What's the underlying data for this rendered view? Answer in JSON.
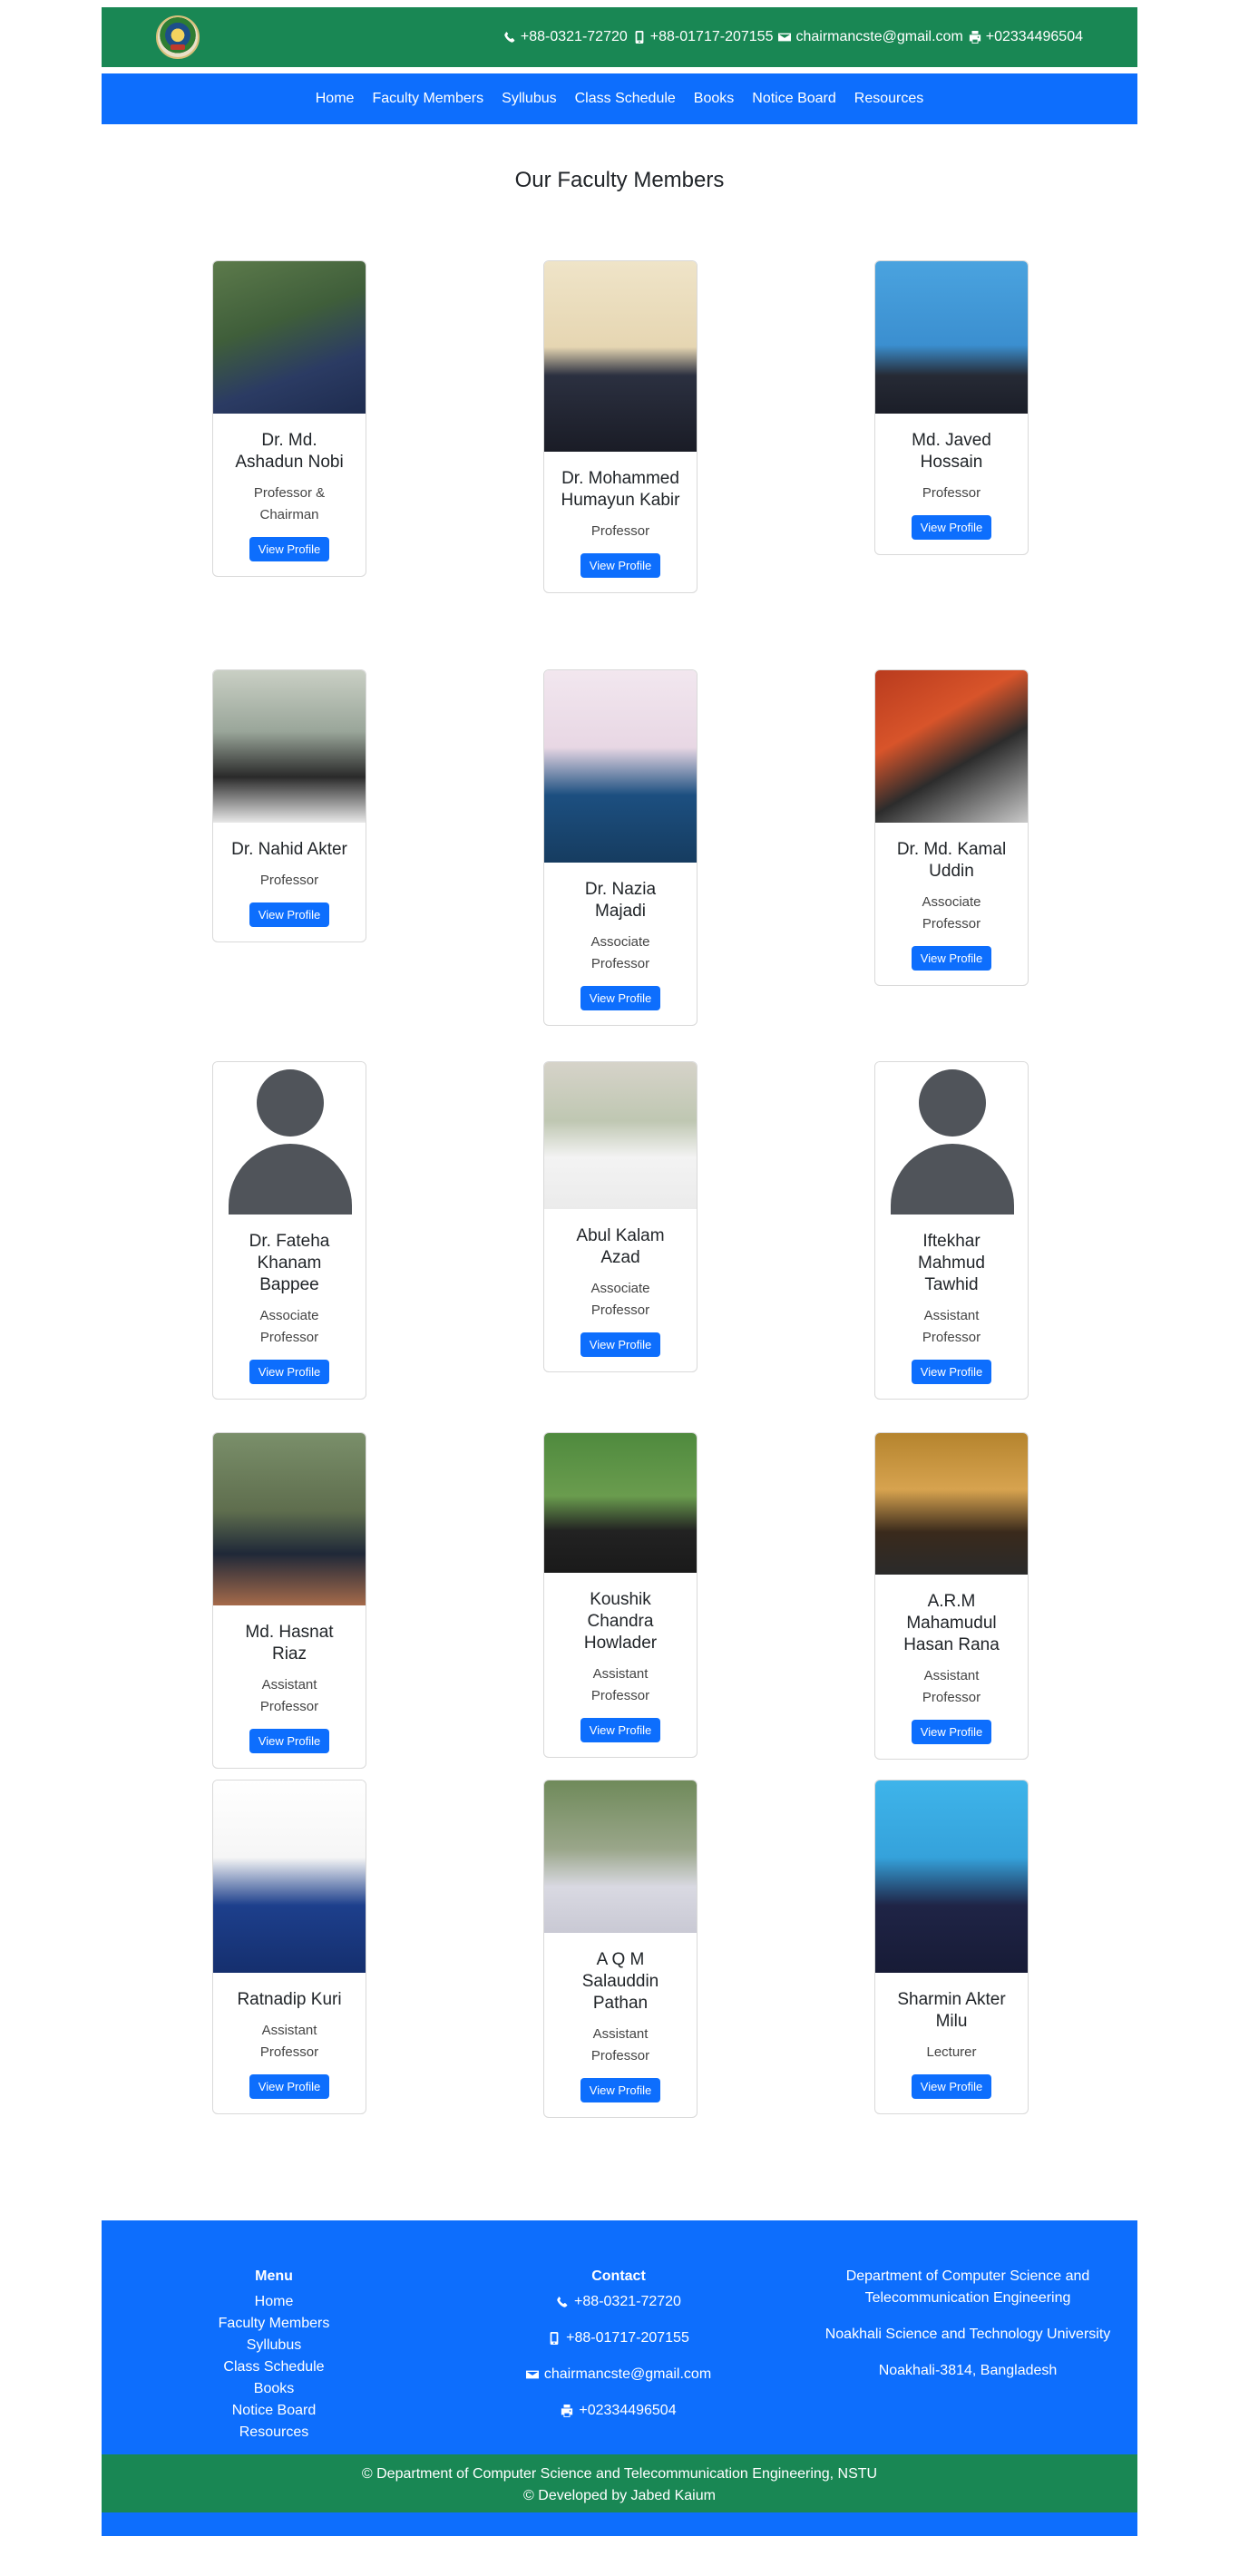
{
  "topbar": {
    "phone1": "+88-0321-72720",
    "mobile": "+88-01717-207155",
    "email": "chairmancste@gmail.com",
    "fax": "+02334496504"
  },
  "nav": {
    "items": [
      "Home",
      "Faculty Members",
      "Syllubus",
      "Class Schedule",
      "Books",
      "Notice Board",
      "Resources"
    ]
  },
  "page_title": "Our Faculty Members",
  "button_label": "View Profile",
  "faculty": [
    {
      "name": "Dr. Md. Ashadun Nobi",
      "role": "Professor & Chairman"
    },
    {
      "name": "Dr. Mohammed Humayun Kabir",
      "role": "Professor"
    },
    {
      "name": "Md. Javed Hossain",
      "role": "Professor"
    },
    {
      "name": "Dr. Nahid Akter",
      "role": "Professor"
    },
    {
      "name": "Dr. Nazia Majadi",
      "role": "Associate Professor"
    },
    {
      "name": "Dr. Md. Kamal Uddin",
      "role": "Associate Professor"
    },
    {
      "name": "Dr. Fateha Khanam Bappee",
      "role": "Associate Professor"
    },
    {
      "name": "Abul Kalam Azad",
      "role": "Associate Professor"
    },
    {
      "name": "Iftekhar Mahmud Tawhid",
      "role": "Assistant Professor"
    },
    {
      "name": "Md. Hasnat Riaz",
      "role": "Assistant Professor"
    },
    {
      "name": "Koushik Chandra Howlader",
      "role": "Assistant Professor"
    },
    {
      "name": "A.R.M Mahamudul Hasan Rana",
      "role": "Assistant Professor"
    },
    {
      "name": "Ratnadip Kuri",
      "role": "Assistant Professor"
    },
    {
      "name": "A Q M Salauddin Pathan",
      "role": "Assistant Professor"
    },
    {
      "name": "Sharmin Akter Milu",
      "role": "Lecturer"
    }
  ],
  "footer": {
    "menu_title": "Menu",
    "menu": [
      "Home",
      "Faculty Members",
      "Syllubus",
      "Class Schedule",
      "Books",
      "Notice Board",
      "Resources"
    ],
    "contact_title": "Contact",
    "contact": [
      "+88-0321-72720",
      "+88-01717-207155",
      "chairmancste@gmail.com",
      "+02334496504"
    ],
    "address": [
      "Department of Computer Science and Telecommunication Engineering",
      "Noakhali Science and Technology University",
      "Noakhali-3814, Bangladesh"
    ],
    "copyright": "© Department of Computer Science and Telecommunication Engineering, NSTU",
    "developer": "© Developed by Jabed Kaium"
  }
}
